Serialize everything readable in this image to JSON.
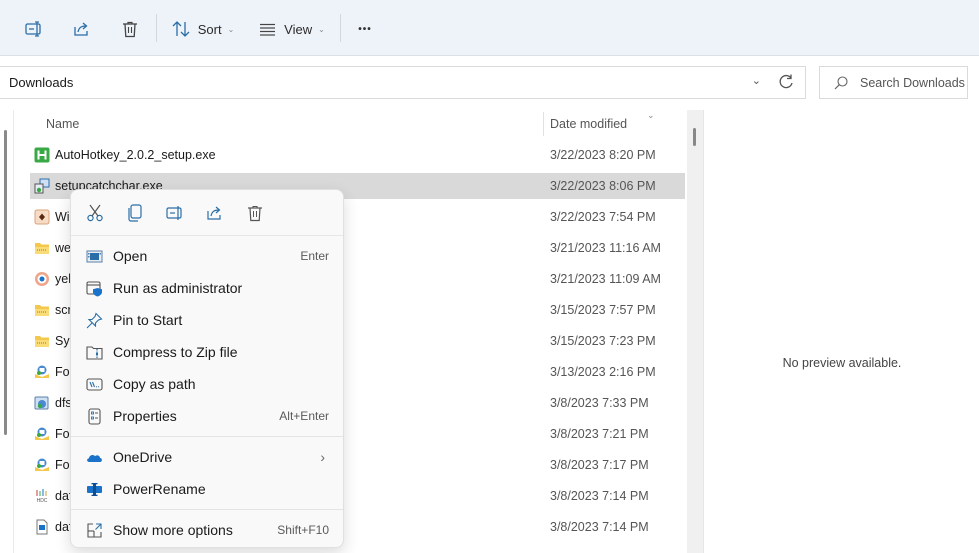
{
  "toolbar": {
    "rename_icon": "rename-icon",
    "share_icon": "share-icon",
    "delete_icon": "trash-icon",
    "sort_label": "Sort",
    "view_label": "View",
    "more_label": "•••"
  },
  "address": {
    "path": "Downloads",
    "search_placeholder": "Search Downloads"
  },
  "columns": {
    "name": "Name",
    "date": "Date modified"
  },
  "files": [
    {
      "name": "AutoHotkey_2.0.2_setup.exe",
      "date": "3/22/2023 8:20 PM",
      "icon": "autohotkey-icon",
      "selected": false
    },
    {
      "name": "setupcatchchar.exe",
      "date": "3/22/2023 8:06 PM",
      "icon": "installer-icon",
      "selected": true
    },
    {
      "name": "Wi",
      "date": "3/22/2023 7:54 PM",
      "icon": "app-icon",
      "selected": false
    },
    {
      "name": "we",
      "date": "3/21/2023 11:16 AM",
      "icon": "zip-folder-icon",
      "selected": false
    },
    {
      "name": "yel",
      "date": "3/21/2023 11:09 AM",
      "icon": "eye-app-icon",
      "selected": false
    },
    {
      "name": "scr",
      "date": "3/15/2023 7:57 PM",
      "icon": "zip-folder-icon",
      "selected": false
    },
    {
      "name": "Sys",
      "date": "3/15/2023 7:23 PM",
      "icon": "zip-folder-icon",
      "selected": false
    },
    {
      "name": "For",
      "date": "3/13/2023 2:16 PM",
      "icon": "setup-icon",
      "selected": false
    },
    {
      "name": "dfs",
      "date": "3/8/2023 7:33 PM",
      "icon": "setup-disk-icon",
      "selected": false
    },
    {
      "name": "For",
      "date": "3/8/2023 7:21 PM",
      "icon": "setup-icon",
      "selected": false
    },
    {
      "name": "For",
      "date": "3/8/2023 7:17 PM",
      "icon": "setup-icon",
      "selected": false
    },
    {
      "name": "daf",
      "date": "3/8/2023 7:14 PM",
      "icon": "hdc-file-icon",
      "selected": false
    },
    {
      "name": "daf",
      "date": "3/8/2023 7:14 PM",
      "icon": "document-icon",
      "selected": false
    }
  ],
  "preview": {
    "message": "No preview available."
  },
  "context_menu": {
    "quick_actions": [
      "cut",
      "copy",
      "rename",
      "share",
      "delete"
    ],
    "items": [
      {
        "label": "Open",
        "shortcut": "Enter",
        "icon": "open-icon"
      },
      {
        "label": "Run as administrator",
        "shortcut": "",
        "icon": "shield-icon"
      },
      {
        "label": "Pin to Start",
        "shortcut": "",
        "icon": "pin-icon"
      },
      {
        "label": "Compress to Zip file",
        "shortcut": "",
        "icon": "zip-icon"
      },
      {
        "label": "Copy as path",
        "shortcut": "",
        "icon": "path-icon"
      },
      {
        "label": "Properties",
        "shortcut": "Alt+Enter",
        "icon": "properties-icon"
      },
      {
        "label": "OneDrive",
        "shortcut": "",
        "icon": "onedrive-icon",
        "submenu": "›"
      },
      {
        "label": "PowerRename",
        "shortcut": "",
        "icon": "powerrename-icon"
      },
      {
        "label": "Show more options",
        "shortcut": "Shift+F10",
        "icon": "more-options-icon"
      }
    ]
  },
  "colors": {
    "toolbar_bg": "#eef2f9",
    "selected_row": "#d9d9d9",
    "accent_blue": "#1a73c8",
    "autohotkey_green": "#3aa845"
  }
}
